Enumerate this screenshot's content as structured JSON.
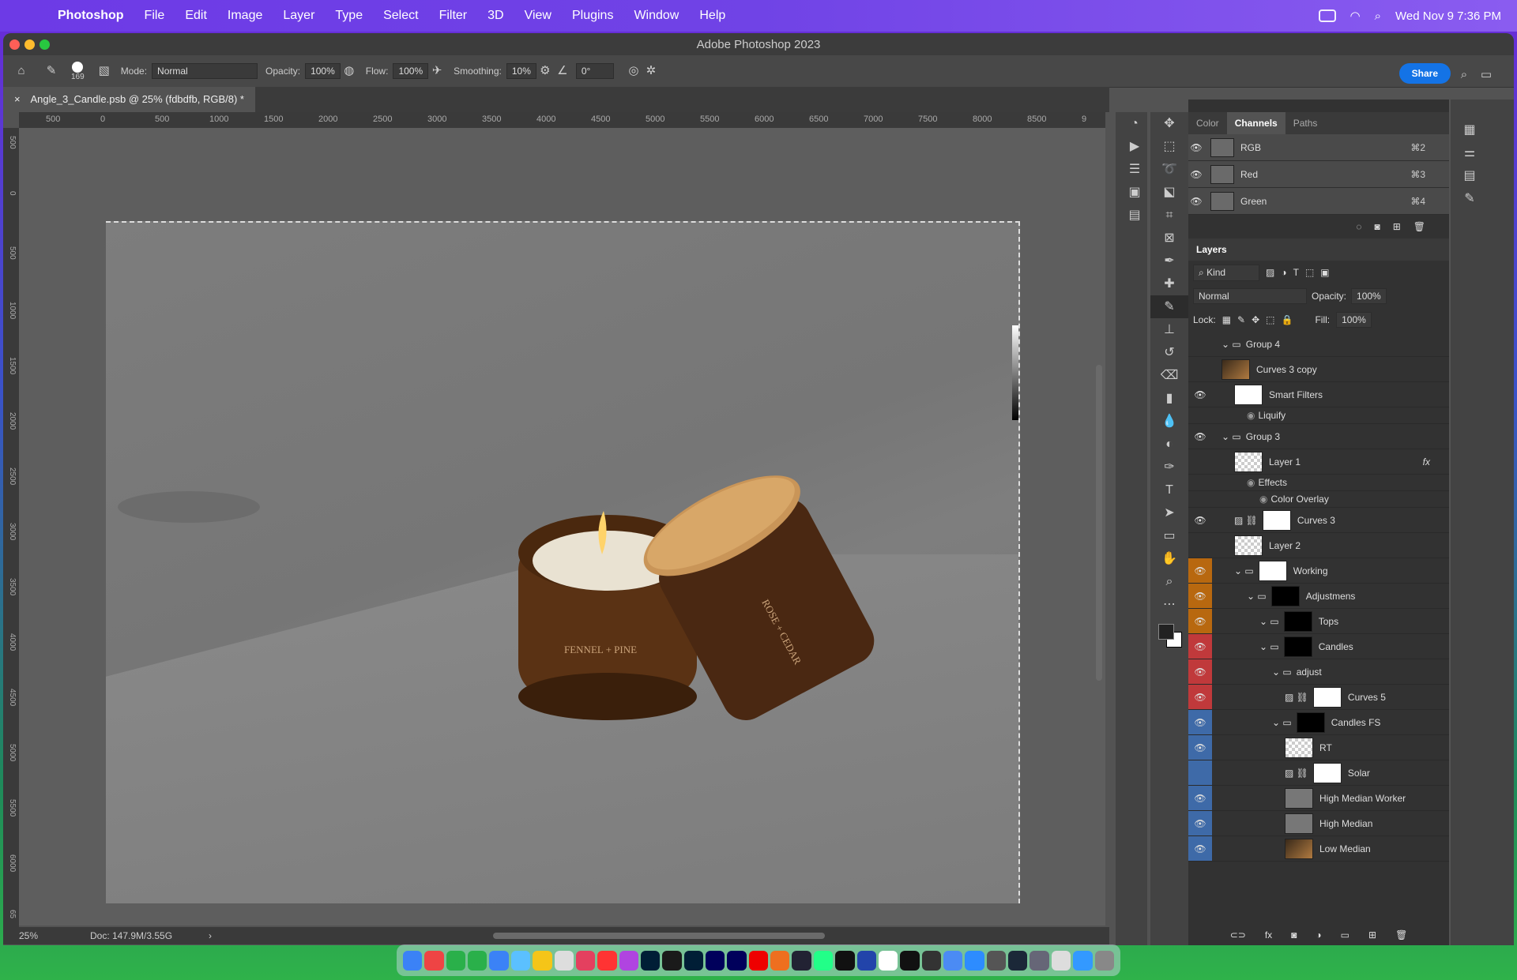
{
  "menubar": {
    "app": "Photoshop",
    "items": [
      "File",
      "Edit",
      "Image",
      "Layer",
      "Type",
      "Select",
      "Filter",
      "3D",
      "View",
      "Plugins",
      "Window",
      "Help"
    ],
    "clock": "Wed Nov 9  7:36 PM"
  },
  "window": {
    "title": "Adobe Photoshop 2023",
    "doc_tab": "Angle_3_Candle.psb @ 25% (fdbdfb, RGB/8) *"
  },
  "options": {
    "brush_size": "169",
    "mode_label": "Mode:",
    "mode_value": "Normal",
    "opacity_label": "Opacity:",
    "opacity_value": "100%",
    "flow_label": "Flow:",
    "flow_value": "100%",
    "smoothing_label": "Smoothing:",
    "smoothing_value": "10%",
    "angle_value": "0°",
    "share": "Share"
  },
  "ruler_h": [
    "500",
    "0",
    "500",
    "1000",
    "1500",
    "2000",
    "2500",
    "3000",
    "3500",
    "4000",
    "4500",
    "5000",
    "5500",
    "6000",
    "6500",
    "7000",
    "7500",
    "8000",
    "8500",
    "9"
  ],
  "ruler_v": [
    "500",
    "0",
    "500",
    "1000",
    "1500",
    "2000",
    "2500",
    "3000",
    "3500",
    "4000",
    "4500",
    "5000",
    "5500",
    "6000",
    "65"
  ],
  "status": {
    "zoom": "25%",
    "doc": "Doc: 147.9M/3.55G"
  },
  "channels": {
    "tabs": [
      "Color",
      "Channels",
      "Paths"
    ],
    "rows": [
      {
        "name": "RGB",
        "shortcut": "⌘2"
      },
      {
        "name": "Red",
        "shortcut": "⌘3"
      },
      {
        "name": "Green",
        "shortcut": "⌘4"
      }
    ]
  },
  "layers": {
    "title": "Layers",
    "filter": "Kind",
    "blend": "Normal",
    "opacity_label": "Opacity:",
    "opacity_value": "100%",
    "lock_label": "Lock:",
    "fill_label": "Fill:",
    "fill_value": "100%",
    "rows": [
      {
        "name": "Group 4",
        "indent": 0,
        "type": "group",
        "eye": false,
        "color": ""
      },
      {
        "name": "Curves 3 copy",
        "indent": 0,
        "type": "photo",
        "eye": false,
        "color": ""
      },
      {
        "name": "Smart Filters",
        "indent": 1,
        "type": "white",
        "eye": true,
        "color": ""
      },
      {
        "name": "Liquify",
        "indent": 2,
        "type": "sub",
        "eye": true,
        "color": ""
      },
      {
        "name": "Group 3",
        "indent": 0,
        "type": "group",
        "eye": true,
        "color": ""
      },
      {
        "name": "Layer 1",
        "indent": 1,
        "type": "checker",
        "eye": false,
        "color": "",
        "fx": "fx"
      },
      {
        "name": "Effects",
        "indent": 2,
        "type": "sub",
        "eye": true,
        "color": ""
      },
      {
        "name": "Color Overlay",
        "indent": 3,
        "type": "sub",
        "eye": true,
        "color": ""
      },
      {
        "name": "Curves 3",
        "indent": 1,
        "type": "adjust",
        "eye": true,
        "color": ""
      },
      {
        "name": "Layer 2",
        "indent": 1,
        "type": "checker",
        "eye": false,
        "color": ""
      },
      {
        "name": "Working",
        "indent": 1,
        "type": "group-white",
        "eye": true,
        "color": "#b8680f"
      },
      {
        "name": "Adjustmens",
        "indent": 2,
        "type": "group-mask",
        "eye": true,
        "color": "#b8680f"
      },
      {
        "name": "Tops",
        "indent": 3,
        "type": "group-mask",
        "eye": true,
        "color": "#b8680f"
      },
      {
        "name": "Candles",
        "indent": 3,
        "type": "group-mask",
        "eye": true,
        "color": "#c0393b"
      },
      {
        "name": "adjust",
        "indent": 4,
        "type": "group",
        "eye": true,
        "color": "#c0393b"
      },
      {
        "name": "Curves 5",
        "indent": 5,
        "type": "adjust",
        "eye": true,
        "color": "#c0393b"
      },
      {
        "name": "Candles FS",
        "indent": 4,
        "type": "group-mask",
        "eye": true,
        "color": "#3e6aa8"
      },
      {
        "name": "RT",
        "indent": 5,
        "type": "checker",
        "eye": true,
        "color": "#3e6aa8"
      },
      {
        "name": "Solar",
        "indent": 5,
        "type": "adjust",
        "eye": false,
        "color": "#3e6aa8"
      },
      {
        "name": "High Median Worker",
        "indent": 5,
        "type": "gray",
        "eye": true,
        "color": "#3e6aa8"
      },
      {
        "name": "High Median",
        "indent": 5,
        "type": "gray",
        "eye": true,
        "color": "#3e6aa8"
      },
      {
        "name": "Low Median",
        "indent": 5,
        "type": "photo",
        "eye": true,
        "color": "#3e6aa8"
      }
    ]
  },
  "tools": [
    "move",
    "marquee",
    "lasso",
    "object-select",
    "crop",
    "frame",
    "eyedropper",
    "healing",
    "brush",
    "stamp",
    "history-brush",
    "eraser",
    "gradient",
    "blur",
    "dodge",
    "pen",
    "type",
    "path-select",
    "rectangle",
    "hand",
    "zoom",
    "more"
  ],
  "candles": {
    "left_label": "FENNEL + PINE",
    "right_label": "ROSE + CEDAR"
  }
}
